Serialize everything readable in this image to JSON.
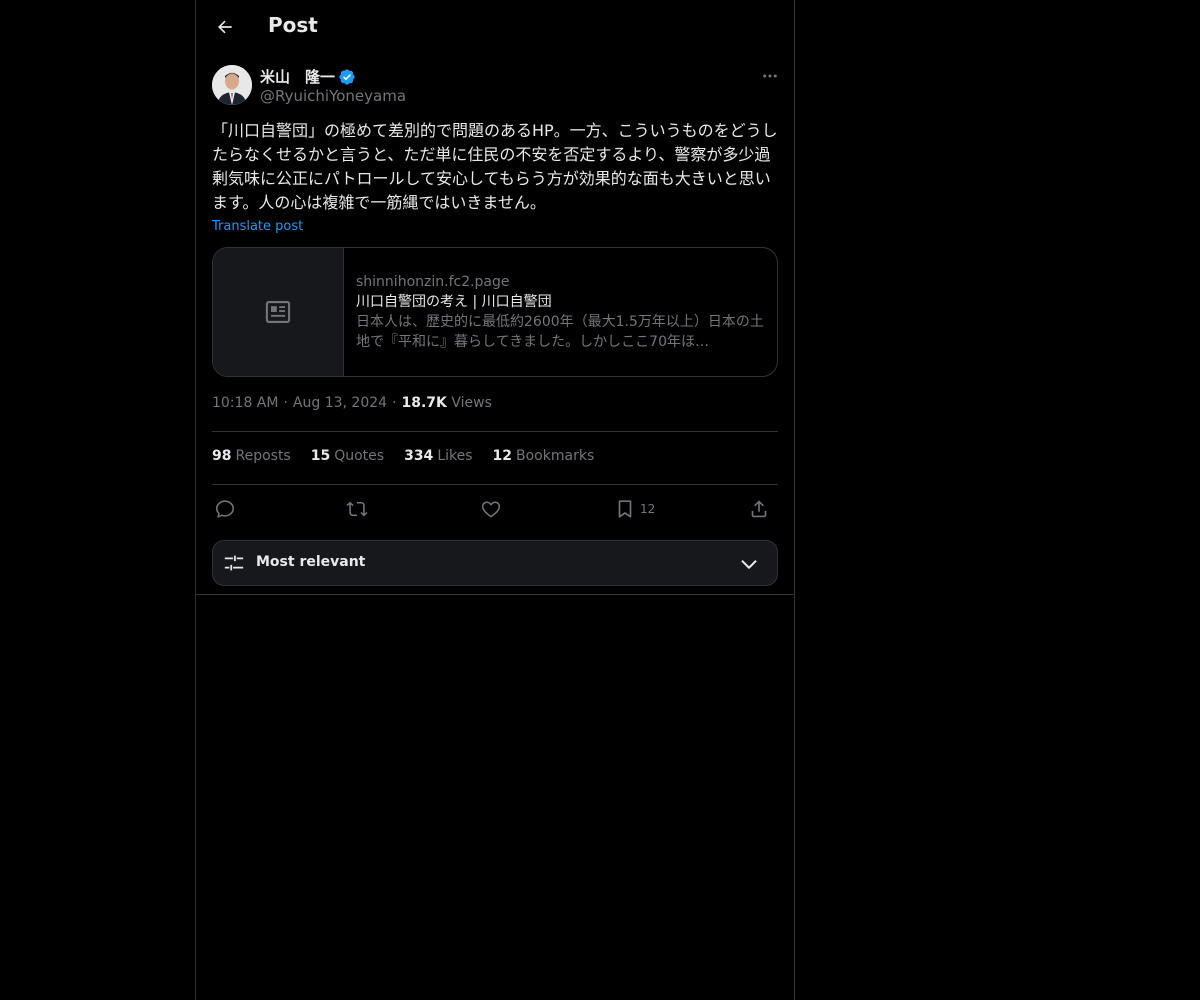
{
  "header": {
    "title": "Post",
    "back_icon": "arrow-left-icon"
  },
  "post": {
    "author": {
      "name": "米山　隆一",
      "handle": "@RyuichiYoneyama",
      "verified": true,
      "verified_color": "#1d9bf0"
    },
    "text": "「川口自警団」の極めて差別的で問題のあるHP。一方、こういうものをどうしたらなくせるかと言うと、ただ単に住民の不安を否定するより、警察が多少過剰気味に公正にパトロールして安心してもらう方が効果的な面も大きいと思います。人の心は複雑で一筋縄ではいきません。",
    "translate_label": "Translate post",
    "card": {
      "domain": "shinnihonzin.fc2.page",
      "title": "川口自警団の考え | 川口自警団",
      "description": "日本人は、歴史的に最低約2600年（最大1.5万年以上）日本の土地で『平和に』暮らしてきました。しかしここ70年ほ…"
    },
    "time": "10:18 AM",
    "date": "Aug 13, 2024",
    "views_count": "18.7K",
    "views_label": "Views",
    "separator": "·"
  },
  "stats": {
    "reposts": {
      "count": "98",
      "label": "Reposts"
    },
    "quotes": {
      "count": "15",
      "label": "Quotes"
    },
    "likes": {
      "count": "334",
      "label": "Likes"
    },
    "bookmarks": {
      "count": "12",
      "label": "Bookmarks"
    }
  },
  "actions": {
    "bookmark_count": "12"
  },
  "sort": {
    "label": "Most relevant"
  },
  "colors": {
    "background": "#000000",
    "text": "#e7e9ea",
    "muted": "#71767b",
    "border": "#2f3336",
    "accent": "#1d9bf0"
  }
}
